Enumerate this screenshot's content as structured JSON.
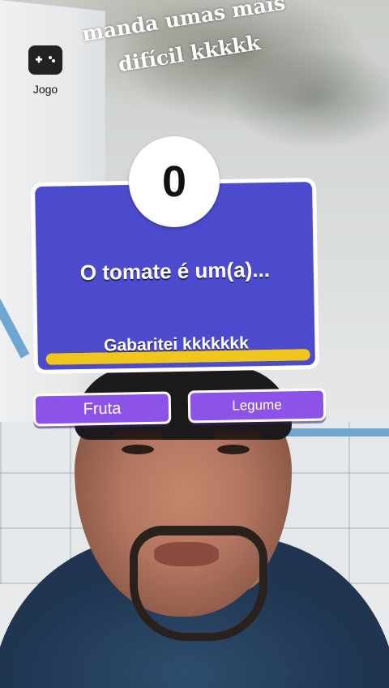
{
  "game_badge": {
    "icon": "gamepad-icon",
    "label": "Jogo"
  },
  "comment": {
    "text": "manda umas mais\ndifícil kkkkk"
  },
  "quiz": {
    "score": "0",
    "question": "O tomate é um(a)...",
    "caption": "Gabaritei kkkkkkk",
    "timer_fraction": 1.0,
    "colors": {
      "card": "#4d4bcd",
      "timer": "#f0c51c",
      "answer": "#8d52e8"
    }
  },
  "answers": [
    {
      "label": "Fruta"
    },
    {
      "label": "Legume"
    }
  ]
}
